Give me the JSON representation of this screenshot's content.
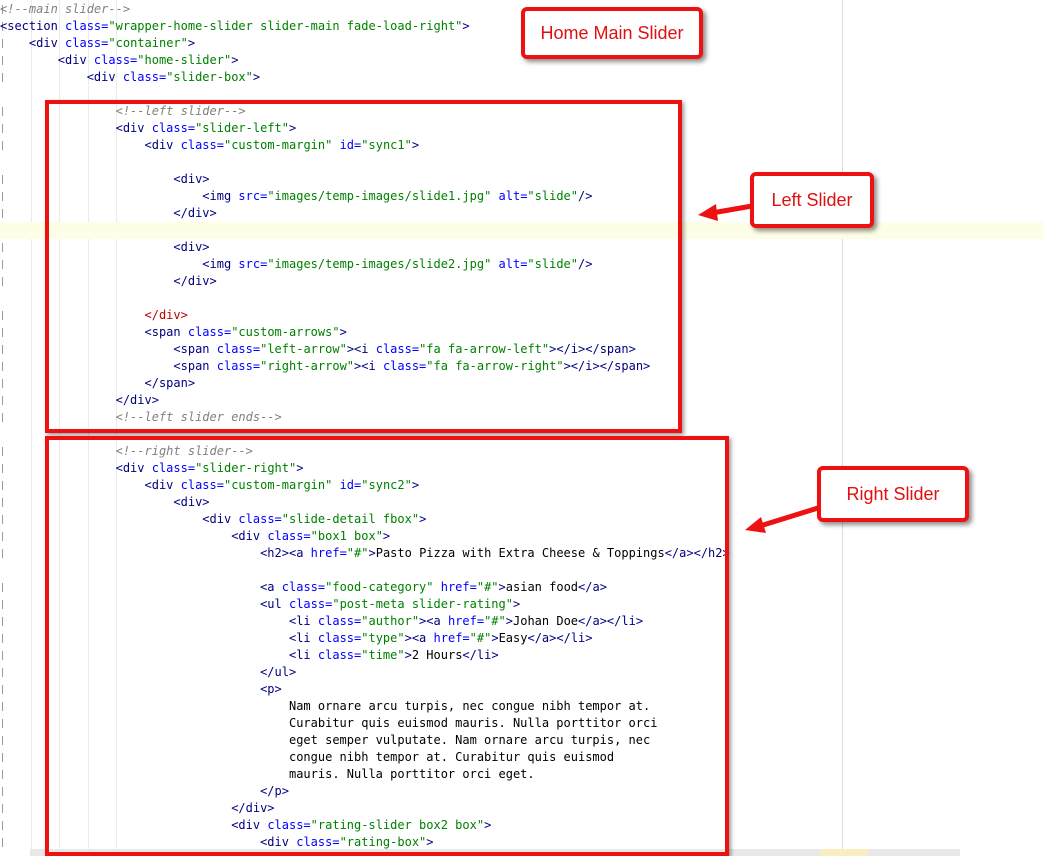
{
  "callouts": {
    "home_main_slider": "Home Main Slider",
    "left_slider": "Left Slider",
    "right_slider": "Right Slider"
  },
  "code_lines": [
    [
      [
        "c",
        "<!--main slider-->"
      ]
    ],
    [
      [
        "g",
        "<section "
      ],
      [
        "a",
        "class="
      ],
      [
        "v",
        "\"wrapper-home-slider slider-main fade-load-right\""
      ],
      [
        "g",
        ">"
      ]
    ],
    [
      [
        "g",
        "    <div "
      ],
      [
        "a",
        "class="
      ],
      [
        "v",
        "\"container\""
      ],
      [
        "g",
        ">"
      ]
    ],
    [
      [
        "g",
        "        <div "
      ],
      [
        "a",
        "class="
      ],
      [
        "v",
        "\"home-slider\""
      ],
      [
        "g",
        ">"
      ]
    ],
    [
      [
        "g",
        "            <div "
      ],
      [
        "a",
        "class="
      ],
      [
        "v",
        "\"slider-box\""
      ],
      [
        "g",
        ">"
      ]
    ],
    [],
    [
      [
        "c",
        "                <!--left slider-->"
      ]
    ],
    [
      [
        "g",
        "                <div "
      ],
      [
        "a",
        "class="
      ],
      [
        "v",
        "\"slider-left\""
      ],
      [
        "g",
        ">"
      ]
    ],
    [
      [
        "g",
        "                    <div "
      ],
      [
        "a",
        "class="
      ],
      [
        "v",
        "\"custom-margin\" "
      ],
      [
        "a",
        "id="
      ],
      [
        "v",
        "\"sync1\""
      ],
      [
        "g",
        ">"
      ]
    ],
    [],
    [
      [
        "g",
        "                        <div>"
      ]
    ],
    [
      [
        "g",
        "                            <img "
      ],
      [
        "a",
        "src="
      ],
      [
        "v",
        "\"images/temp-images/slide1.jpg\" "
      ],
      [
        "a",
        "alt="
      ],
      [
        "v",
        "\"slide\""
      ],
      [
        "g",
        "/>"
      ]
    ],
    [
      [
        "g",
        "                        </div>"
      ]
    ],
    [],
    [
      [
        "g",
        "                        <div>"
      ]
    ],
    [
      [
        "g",
        "                            <img "
      ],
      [
        "a",
        "src="
      ],
      [
        "v",
        "\"images/temp-images/slide2.jpg\" "
      ],
      [
        "a",
        "alt="
      ],
      [
        "v",
        "\"slide\""
      ],
      [
        "g",
        "/>"
      ]
    ],
    [
      [
        "g",
        "                        </div>"
      ]
    ],
    [],
    [
      [
        "r",
        "                    </div>"
      ]
    ],
    [
      [
        "g",
        "                    <span "
      ],
      [
        "a",
        "class="
      ],
      [
        "v",
        "\"custom-arrows\""
      ],
      [
        "g",
        ">"
      ]
    ],
    [
      [
        "g",
        "                        <span "
      ],
      [
        "a",
        "class="
      ],
      [
        "v",
        "\"left-arrow\""
      ],
      [
        "g",
        "><i "
      ],
      [
        "a",
        "class="
      ],
      [
        "v",
        "\"fa fa-arrow-left\""
      ],
      [
        "g",
        "></i></span>"
      ]
    ],
    [
      [
        "g",
        "                        <span "
      ],
      [
        "a",
        "class="
      ],
      [
        "v",
        "\"right-arrow\""
      ],
      [
        "g",
        "><i "
      ],
      [
        "a",
        "class="
      ],
      [
        "v",
        "\"fa fa-arrow-right\""
      ],
      [
        "g",
        "></i></span>"
      ]
    ],
    [
      [
        "g",
        "                    </span>"
      ]
    ],
    [
      [
        "g",
        "                </div>"
      ]
    ],
    [
      [
        "c",
        "                <!--left slider ends-->"
      ]
    ],
    [],
    [
      [
        "c",
        "                <!--right slider-->"
      ]
    ],
    [
      [
        "g",
        "                <div "
      ],
      [
        "a",
        "class="
      ],
      [
        "v",
        "\"slider-right\""
      ],
      [
        "g",
        ">"
      ]
    ],
    [
      [
        "g",
        "                    <div "
      ],
      [
        "a",
        "class="
      ],
      [
        "v",
        "\"custom-margin\" "
      ],
      [
        "a",
        "id="
      ],
      [
        "v",
        "\"sync2\""
      ],
      [
        "g",
        ">"
      ]
    ],
    [
      [
        "g",
        "                        <div>"
      ]
    ],
    [
      [
        "g",
        "                            <div "
      ],
      [
        "a",
        "class="
      ],
      [
        "v",
        "\"slide-detail fbox\""
      ],
      [
        "g",
        ">"
      ]
    ],
    [
      [
        "g",
        "                                <div "
      ],
      [
        "a",
        "class="
      ],
      [
        "v",
        "\"box1 box\""
      ],
      [
        "g",
        ">"
      ]
    ],
    [
      [
        "g",
        "                                    <h2><a "
      ],
      [
        "a",
        "href="
      ],
      [
        "v",
        "\"#\""
      ],
      [
        "g",
        ">"
      ],
      [
        "t",
        "Pasto Pizza with Extra Cheese & Toppings"
      ],
      [
        "g",
        "</a></h2>"
      ]
    ],
    [],
    [
      [
        "g",
        "                                    <a "
      ],
      [
        "a",
        "class="
      ],
      [
        "v",
        "\"food-category\" "
      ],
      [
        "a",
        "href="
      ],
      [
        "v",
        "\"#\""
      ],
      [
        "g",
        ">"
      ],
      [
        "t",
        "asian food"
      ],
      [
        "g",
        "</a>"
      ]
    ],
    [
      [
        "g",
        "                                    <ul "
      ],
      [
        "a",
        "class="
      ],
      [
        "v",
        "\"post-meta slider-rating\""
      ],
      [
        "g",
        ">"
      ]
    ],
    [
      [
        "g",
        "                                        <li "
      ],
      [
        "a",
        "class="
      ],
      [
        "v",
        "\"author\""
      ],
      [
        "g",
        "><a "
      ],
      [
        "a",
        "href="
      ],
      [
        "v",
        "\"#\""
      ],
      [
        "g",
        ">"
      ],
      [
        "t",
        "Johan Doe"
      ],
      [
        "g",
        "</a></li>"
      ]
    ],
    [
      [
        "g",
        "                                        <li "
      ],
      [
        "a",
        "class="
      ],
      [
        "v",
        "\"type\""
      ],
      [
        "g",
        "><a "
      ],
      [
        "a",
        "href="
      ],
      [
        "v",
        "\"#\""
      ],
      [
        "g",
        ">"
      ],
      [
        "t",
        "Easy"
      ],
      [
        "g",
        "</a></li>"
      ]
    ],
    [
      [
        "g",
        "                                        <li "
      ],
      [
        "a",
        "class="
      ],
      [
        "v",
        "\"time\""
      ],
      [
        "g",
        ">"
      ],
      [
        "t",
        "2 Hours"
      ],
      [
        "g",
        "</li>"
      ]
    ],
    [
      [
        "g",
        "                                    </ul>"
      ]
    ],
    [
      [
        "g",
        "                                    <p>"
      ]
    ],
    [
      [
        "t",
        "                                        Nam ornare arcu turpis, nec congue nibh tempor at."
      ]
    ],
    [
      [
        "t",
        "                                        Curabitur quis euismod mauris. Nulla porttitor orci"
      ]
    ],
    [
      [
        "t",
        "                                        eget semper vulputate. Nam ornare arcu turpis, nec"
      ]
    ],
    [
      [
        "t",
        "                                        congue nibh tempor at. Curabitur quis euismod"
      ]
    ],
    [
      [
        "t",
        "                                        mauris. Nulla porttitor orci eget."
      ]
    ],
    [
      [
        "g",
        "                                    </p>"
      ]
    ],
    [
      [
        "g",
        "                                </div>"
      ]
    ],
    [
      [
        "g",
        "                                <div "
      ],
      [
        "a",
        "class="
      ],
      [
        "v",
        "\"rating-slider box2 box\""
      ],
      [
        "g",
        ">"
      ]
    ],
    [
      [
        "g",
        "                                    <div "
      ],
      [
        "a",
        "class="
      ],
      [
        "v",
        "\"rating-box\""
      ],
      [
        "g",
        ">"
      ]
    ]
  ],
  "highlighted_line_index": 13,
  "colors": {
    "tag": "#000080",
    "attribute": "#0000ff",
    "value": "#008000",
    "comment": "#808080",
    "annotation_red": "#ee1111"
  }
}
